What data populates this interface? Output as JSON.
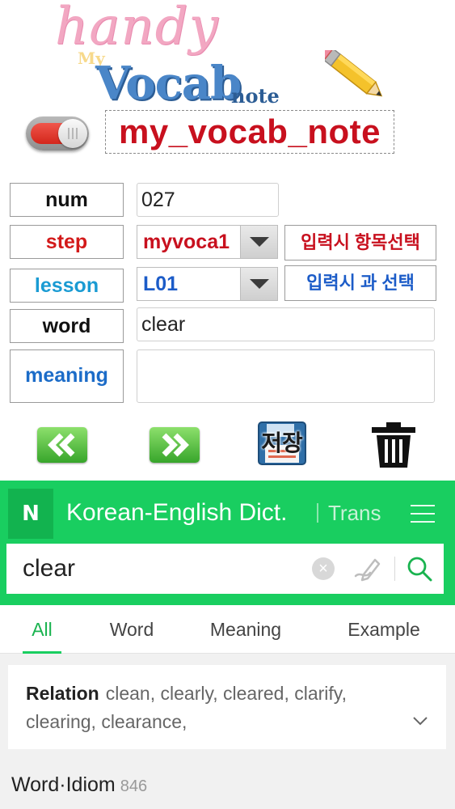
{
  "logo": {
    "my": "My",
    "handy": "handy",
    "vocab": "Vocab",
    "note": "note"
  },
  "app_title": "my_vocab_note",
  "form": {
    "num": {
      "label": "num",
      "label_color": "#111111",
      "value": "027"
    },
    "step": {
      "label": "step",
      "label_color": "#d31a1a",
      "value": "myvoca1",
      "value_color": "#c8101e",
      "hint": "입력시 항목선택",
      "hint_color": "#c8101e"
    },
    "lesson": {
      "label": "lesson",
      "label_color": "#1a9bd3",
      "value": "L01",
      "value_color": "#1c5cc8",
      "hint": "입력시 과 선택",
      "hint_color": "#1c5cc8"
    },
    "word": {
      "label": "word",
      "label_color": "#111111",
      "value": "clear"
    },
    "meaning": {
      "label": "meaning",
      "label_color": "#1c6cc8",
      "value": ""
    }
  },
  "actions": {
    "prev_icon": "double-chevron-left-icon",
    "next_icon": "double-chevron-right-icon",
    "save_label": "저장",
    "delete_icon": "trash-icon"
  },
  "dictionary": {
    "logo": "N",
    "title": "Korean-English Dict.",
    "trans": "Trans",
    "search_value": "clear",
    "clear_glyph": "×",
    "brand_color": "#19ce60"
  },
  "tabs": [
    {
      "label": "All",
      "active": true
    },
    {
      "label": "Word",
      "active": false
    },
    {
      "label": "Meaning",
      "active": false
    },
    {
      "label": "Example",
      "active": false
    }
  ],
  "results": {
    "relation_label": "Relation",
    "relation_words": "clean, clearly, cleared, clarify, clearing, clearance,",
    "section_title": "Word·Idiom",
    "section_count": "846"
  }
}
